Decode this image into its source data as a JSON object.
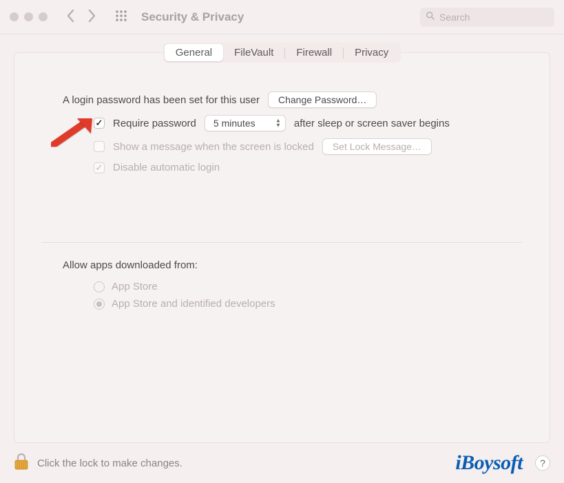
{
  "window": {
    "title": "Security & Privacy"
  },
  "search": {
    "placeholder": "Search"
  },
  "tabs": [
    "General",
    "FileVault",
    "Firewall",
    "Privacy"
  ],
  "active_tab": "General",
  "general": {
    "login_password_msg": "A login password has been set for this user",
    "change_password_btn": "Change Password…",
    "require_password": {
      "checked": true,
      "label_before": "Require password",
      "delay": "5 minutes",
      "label_after": "after sleep or screen saver begins"
    },
    "show_message": {
      "checked": false,
      "label": "Show a message when the screen is locked",
      "button": "Set Lock Message…"
    },
    "disable_auto_login": {
      "checked": true,
      "label": "Disable automatic login"
    },
    "allow_apps": {
      "heading": "Allow apps downloaded from:",
      "options": [
        "App Store",
        "App Store and identified developers"
      ],
      "selected_index": 1
    }
  },
  "footer": {
    "lock_msg": "Click the lock to make changes.",
    "watermark": "iBoysoft"
  },
  "colors": {
    "accent": "#0b5db3",
    "arrow": "#e03b2a"
  }
}
